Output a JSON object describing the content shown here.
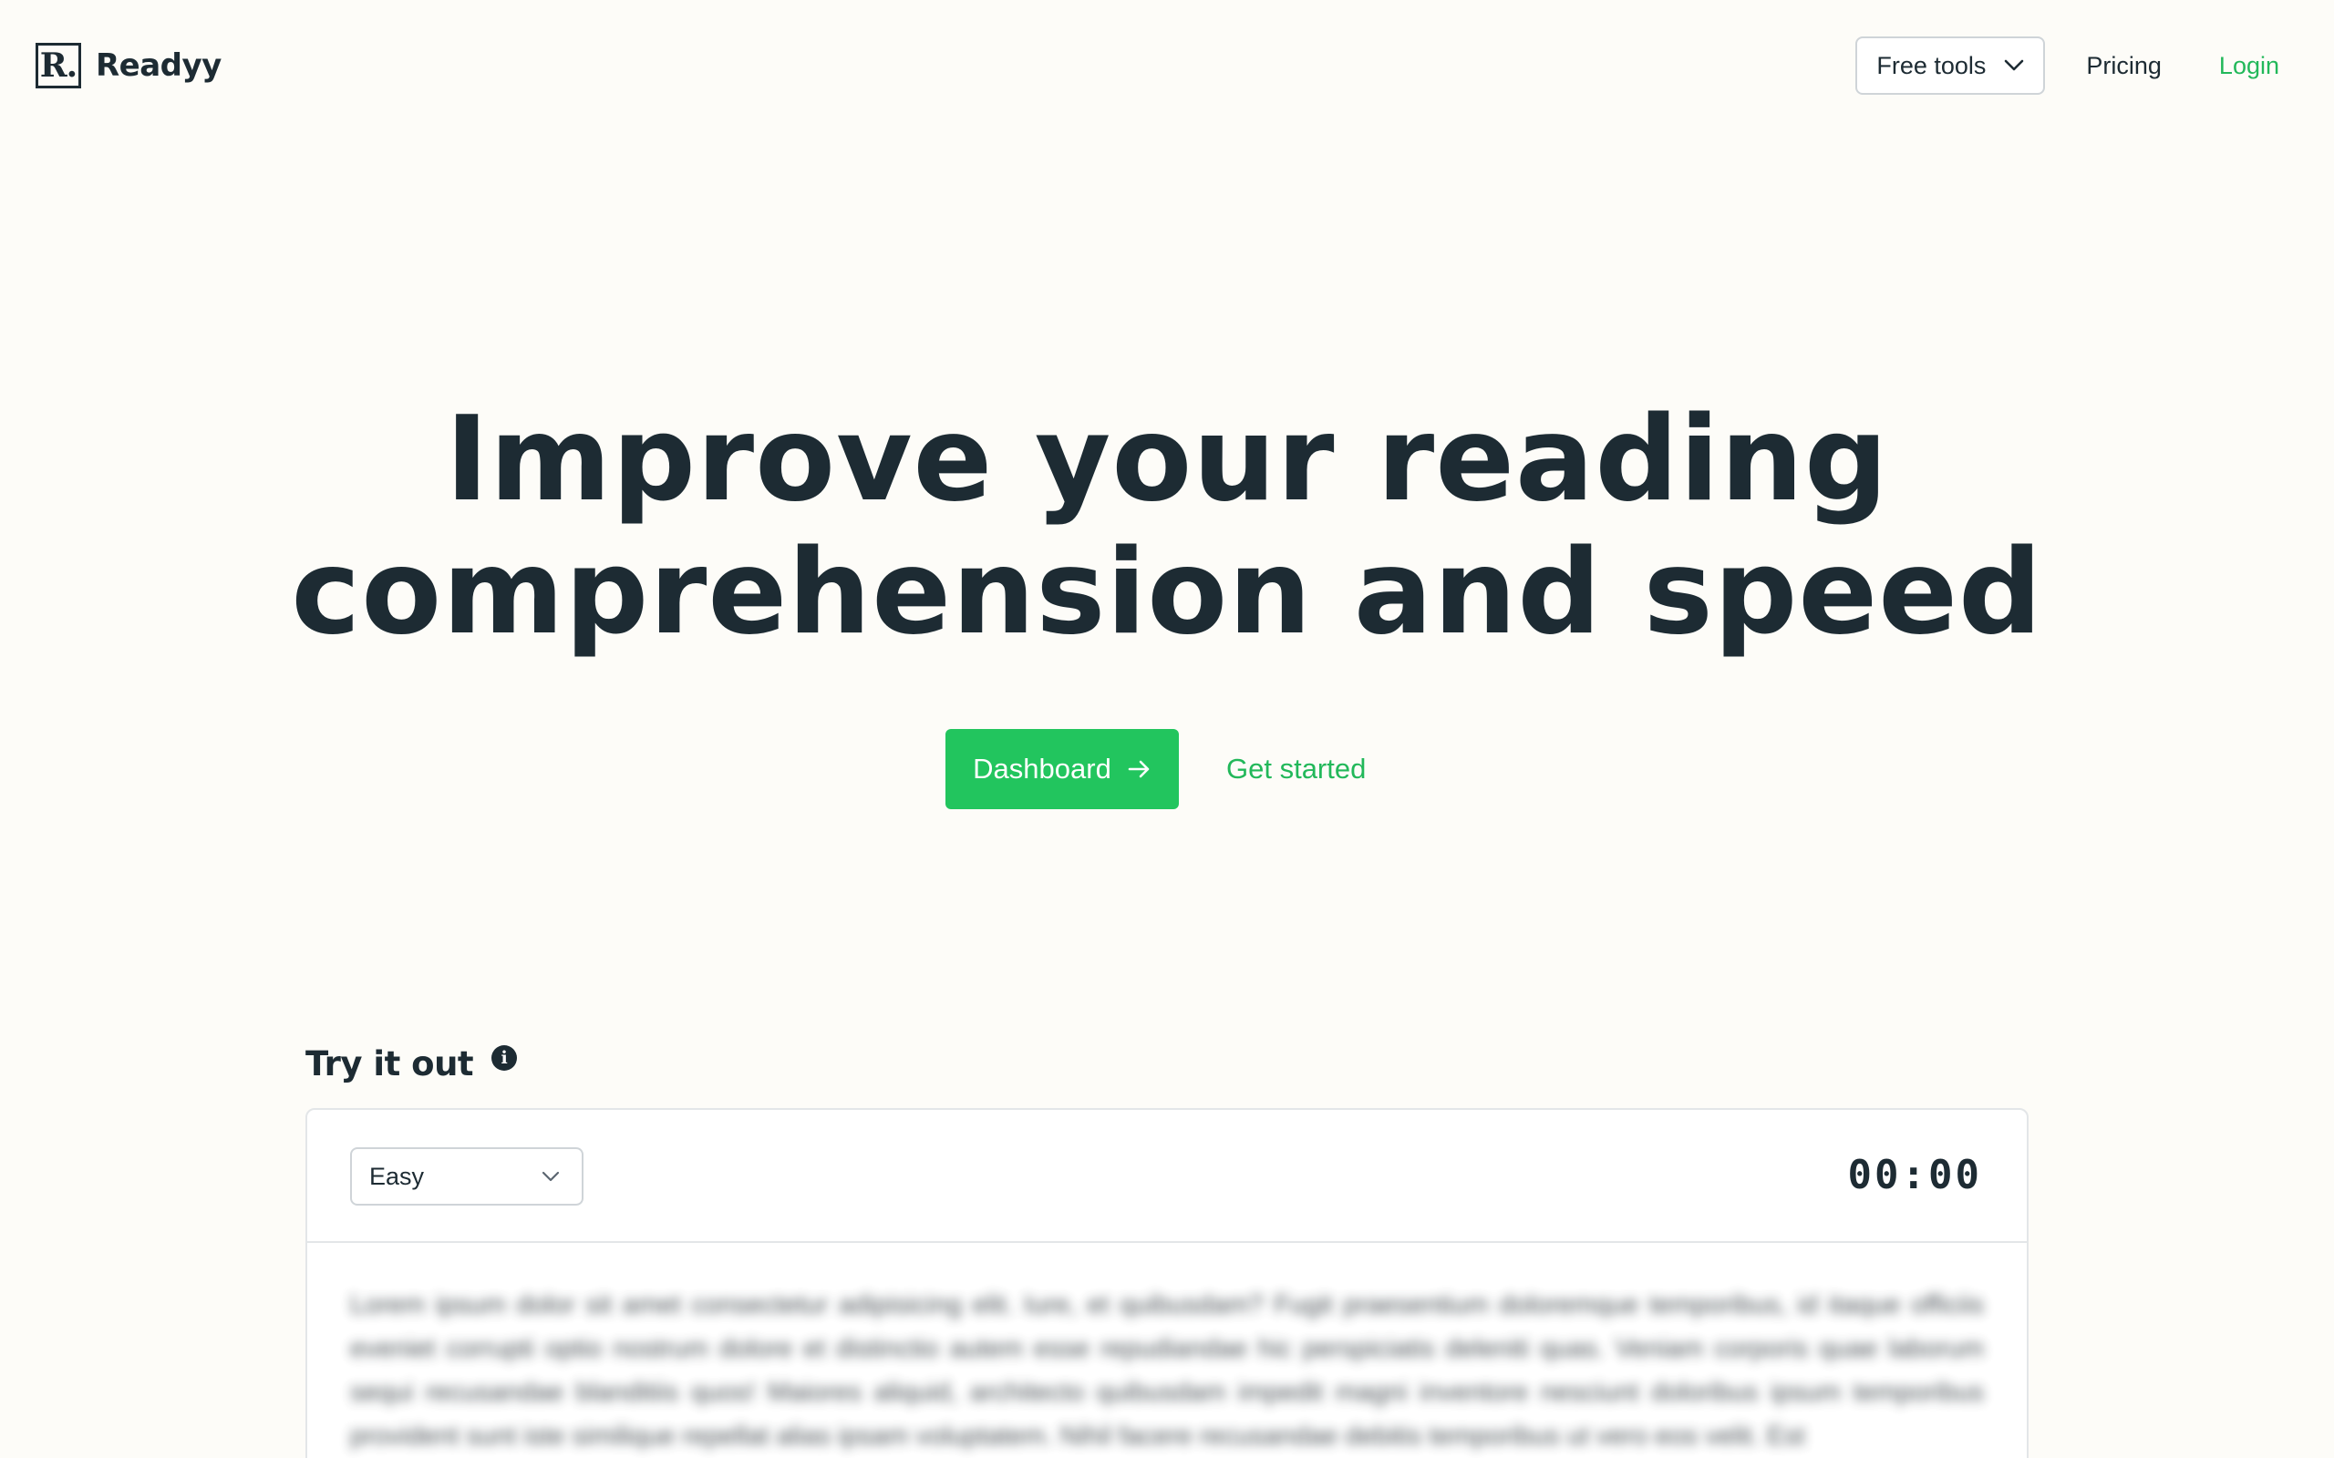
{
  "brand": {
    "mark": "R.",
    "name": "Readyy"
  },
  "nav": {
    "tools_label": "Free tools",
    "pricing_label": "Pricing",
    "login_label": "Login"
  },
  "hero": {
    "title_line1": "Improve your reading",
    "title_line2": "comprehension and speed",
    "dashboard_label": "Dashboard",
    "get_started_label": "Get started"
  },
  "try_it": {
    "title": "Try it out",
    "info_glyph": "i",
    "level_selected": "Easy",
    "timer": "00:00",
    "sample_text": "Lorem ipsum dolor sit amet consectetur adipisicing elit. Iure, et quibusdam? Fugit praesentium doloremque temporibus, id itaque officiis eveniet corrupti optio nostrum dolore et distinctio autem esse repudiandae hic perspiciatis deleniti quas. Veniam corporis quae laborum sequi recusandae blanditiis quos! Maiores aliquid, architecto quibusdam impedit magni inventore nesciunt doloribus ipsum temporibus provident sunt iste similique repellat alias ipsam voluptatem. Nihil facere recusandae debitis temporibus ut vero eos velit. Est"
  },
  "colors": {
    "accent": "#22c55e",
    "text": "#1d2b33",
    "background": "#fdfcf8"
  }
}
